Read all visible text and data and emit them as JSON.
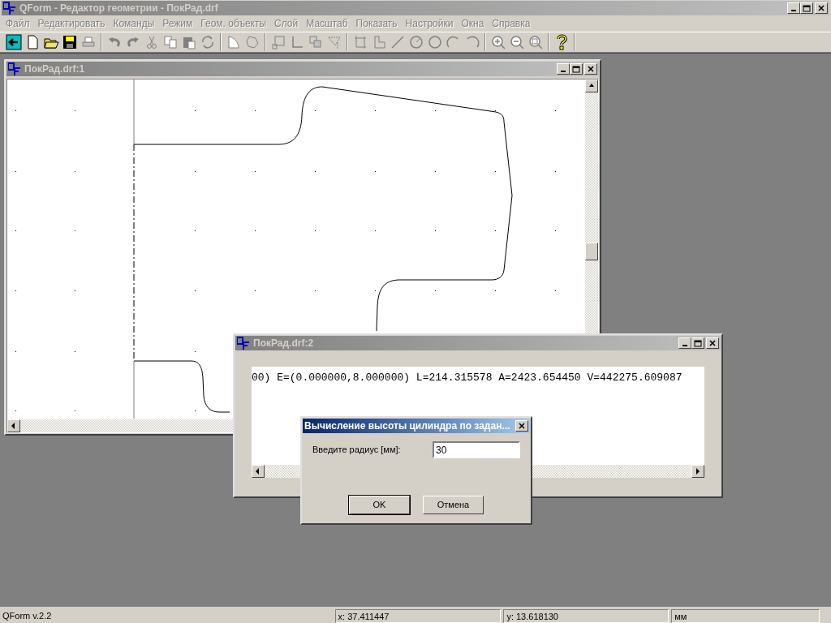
{
  "window": {
    "title": "QForm - Редактор геометрии  - ПокРад.drf",
    "active": false
  },
  "menu": [
    {
      "label": "Файл",
      "disabled": true
    },
    {
      "label": "Редактировать",
      "disabled": true
    },
    {
      "label": "Команды",
      "disabled": true
    },
    {
      "label": "Режим",
      "disabled": true
    },
    {
      "label": "Геом. объекты",
      "disabled": true
    },
    {
      "label": "Слой",
      "disabled": true
    },
    {
      "label": "Масштаб",
      "disabled": true
    },
    {
      "label": "Показать",
      "disabled": true
    },
    {
      "label": "Настройки",
      "disabled": true
    },
    {
      "label": "Окна",
      "disabled": true
    },
    {
      "label": "Справка",
      "disabled": true
    }
  ],
  "drawing_window": {
    "title": "ПокРад.drf:1",
    "active": false
  },
  "output_window": {
    "title": "ПокРад.drf:2",
    "active": false,
    "text": "00) E=(0.000000,8.000000) L=214.315578 A=2423.654450 V=442275.609087"
  },
  "dialog": {
    "title": "Вычисление высоты цилиндра по задан...",
    "active": true,
    "label": "Введите радиус [мм]:",
    "value": "30",
    "buttons": [
      {
        "label": "OK",
        "default": true
      },
      {
        "label": "Отмена",
        "default": false
      }
    ]
  },
  "status_bar": [
    {
      "text": "QForm v.2.2"
    },
    {
      "text": "x: 37.411447"
    },
    {
      "text": "y: 13.618130"
    },
    {
      "text": "мм"
    }
  ]
}
